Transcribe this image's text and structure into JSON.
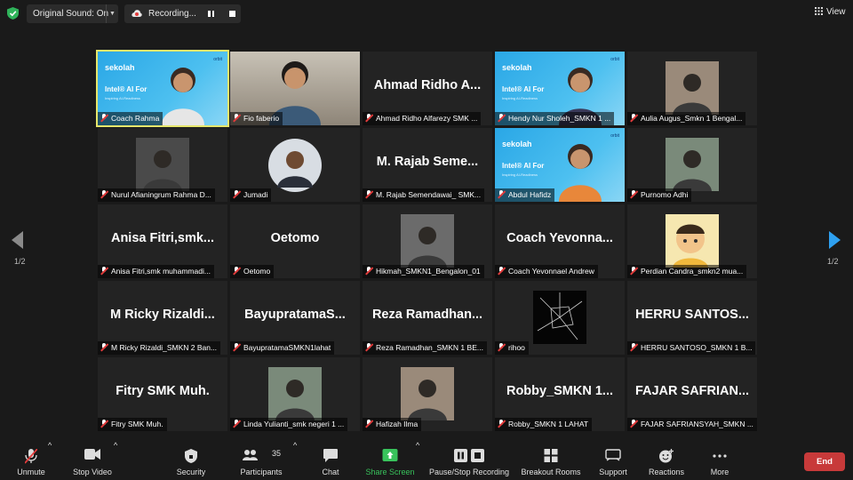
{
  "top": {
    "original_sound": "Original Sound: On",
    "recording": "Recording...",
    "view": "View"
  },
  "nav": {
    "page_left": "1/2",
    "page_right": "1/2"
  },
  "tiles": [
    {
      "name": "Coach Rahma",
      "big": "",
      "type": "banner",
      "active": true
    },
    {
      "name": "Fio faberio",
      "big": "",
      "type": "video"
    },
    {
      "name": "Ahmad Ridho Alfarezy SMK ...",
      "big": "Ahmad Ridho A...",
      "type": "name"
    },
    {
      "name": "Hendy Nur Sholeh_SMKN 1 ...",
      "big": "",
      "type": "banner"
    },
    {
      "name": "Aulia Augus_Smkn 1 Bengal...",
      "big": "",
      "type": "photo"
    },
    {
      "name": "Nurul Afianingrum Rahma D...",
      "big": "",
      "type": "photo"
    },
    {
      "name": "Jumadi",
      "big": "",
      "type": "avatar"
    },
    {
      "name": "M. Rajab Semendawai_ SMK...",
      "big": "M. Rajab Seme...",
      "type": "name"
    },
    {
      "name": "Abdul Hafidz",
      "big": "",
      "type": "banner"
    },
    {
      "name": "Purnomo Adhi",
      "big": "",
      "type": "photo"
    },
    {
      "name": "Anisa Fitri,smk muhammadi...",
      "big": "Anisa Fitri,smk...",
      "type": "name"
    },
    {
      "name": "Oetomo",
      "big": "Oetomo",
      "type": "name"
    },
    {
      "name": "Hikmah_SMKN1_Bengalon_01",
      "big": "",
      "type": "photo"
    },
    {
      "name": "Coach Yevonnael Andrew",
      "big": "Coach Yevonna...",
      "type": "name"
    },
    {
      "name": "Perdian Candra_smkn2 mua...",
      "big": "",
      "type": "cartoon"
    },
    {
      "name": "M Ricky Rizaldi_SMKN 2 Ban...",
      "big": "M Ricky Rizaldi...",
      "type": "name"
    },
    {
      "name": "BayupratamaSMKN1lahat",
      "big": "BayupratamaS...",
      "type": "name"
    },
    {
      "name": "Reza Ramadhan_SMKN 1 BE...",
      "big": "Reza Ramadhan...",
      "type": "name"
    },
    {
      "name": "rihoo",
      "big": "",
      "type": "glass"
    },
    {
      "name": "HERRU SANTOSO_SMKN 1 B...",
      "big": "HERRU SANTOS...",
      "type": "name"
    },
    {
      "name": "Fitry SMK Muh.",
      "big": "Fitry SMK Muh.",
      "type": "name"
    },
    {
      "name": "Linda Yulianti_smk negeri 1 ...",
      "big": "",
      "type": "photo"
    },
    {
      "name": "Hafizah Ilma",
      "big": "",
      "type": "photo"
    },
    {
      "name": "Robby_SMKN 1 LAHAT",
      "big": "Robby_SMKN 1...",
      "type": "name"
    },
    {
      "name": "FAJAR SAFRIANSYAH_SMKN ...",
      "big": "FAJAR SAFRIAN...",
      "type": "name"
    }
  ],
  "banner": {
    "logo": "sekolah",
    "intel": "Intel® AI For",
    "tag": "Inspiring AI-Readiness",
    "orbit": "orbit"
  },
  "bottom": {
    "unmute": "Unmute",
    "stop_video": "Stop Video",
    "security": "Security",
    "participants": "Participants",
    "participants_count": "35",
    "chat": "Chat",
    "share_screen": "Share Screen",
    "record": "Pause/Stop Recording",
    "breakout": "Breakout Rooms",
    "support": "Support",
    "reactions": "Reactions",
    "more": "More",
    "end": "End"
  },
  "colors": {
    "active_border": "#e6e66b",
    "share_green": "#38c25b",
    "end_red": "#c83a3a"
  }
}
